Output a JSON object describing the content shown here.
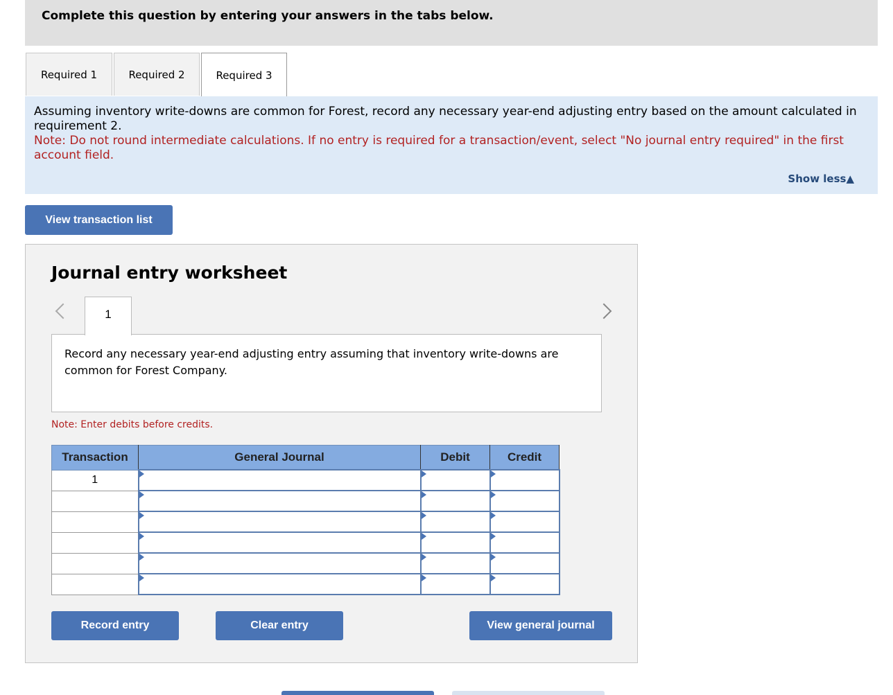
{
  "header": {
    "title": "Complete this question by entering your answers in the tabs below."
  },
  "tabs": [
    {
      "label": "Required 1",
      "active": false
    },
    {
      "label": "Required 2",
      "active": false
    },
    {
      "label": "Required 3",
      "active": true
    }
  ],
  "instructions": {
    "text": "Assuming inventory write-downs are common for Forest, record any necessary year-end adjusting entry based on the amount calculated in requirement 2.",
    "note": "Note: Do not round intermediate calculations. If no entry is required for a transaction/event, select \"No journal entry required\" in the first account field.",
    "show_less": "Show less",
    "show_less_icon": "triangle-up-icon"
  },
  "view_transaction_list": "View transaction list",
  "worksheet": {
    "title": "Journal entry worksheet",
    "current_entry": "1",
    "entry_description": "Record any necessary year-end adjusting entry assuming that inventory write-downs are common for Forest Company.",
    "note": "Note: Enter debits before credits.",
    "columns": [
      "Transaction",
      "General Journal",
      "Debit",
      "Credit"
    ],
    "rows": [
      {
        "transaction": "1",
        "account": "",
        "debit": "",
        "credit": ""
      },
      {
        "transaction": "",
        "account": "",
        "debit": "",
        "credit": ""
      },
      {
        "transaction": "",
        "account": "",
        "debit": "",
        "credit": ""
      },
      {
        "transaction": "",
        "account": "",
        "debit": "",
        "credit": ""
      },
      {
        "transaction": "",
        "account": "",
        "debit": "",
        "credit": ""
      },
      {
        "transaction": "",
        "account": "",
        "debit": "",
        "credit": ""
      }
    ],
    "buttons": {
      "record": "Record entry",
      "clear": "Clear entry",
      "view_journal": "View general journal"
    }
  },
  "colors": {
    "accent": "#4a74b5",
    "note_red": "#b22222",
    "instructions_bg": "#deeaf7",
    "table_header": "#84abe0"
  }
}
